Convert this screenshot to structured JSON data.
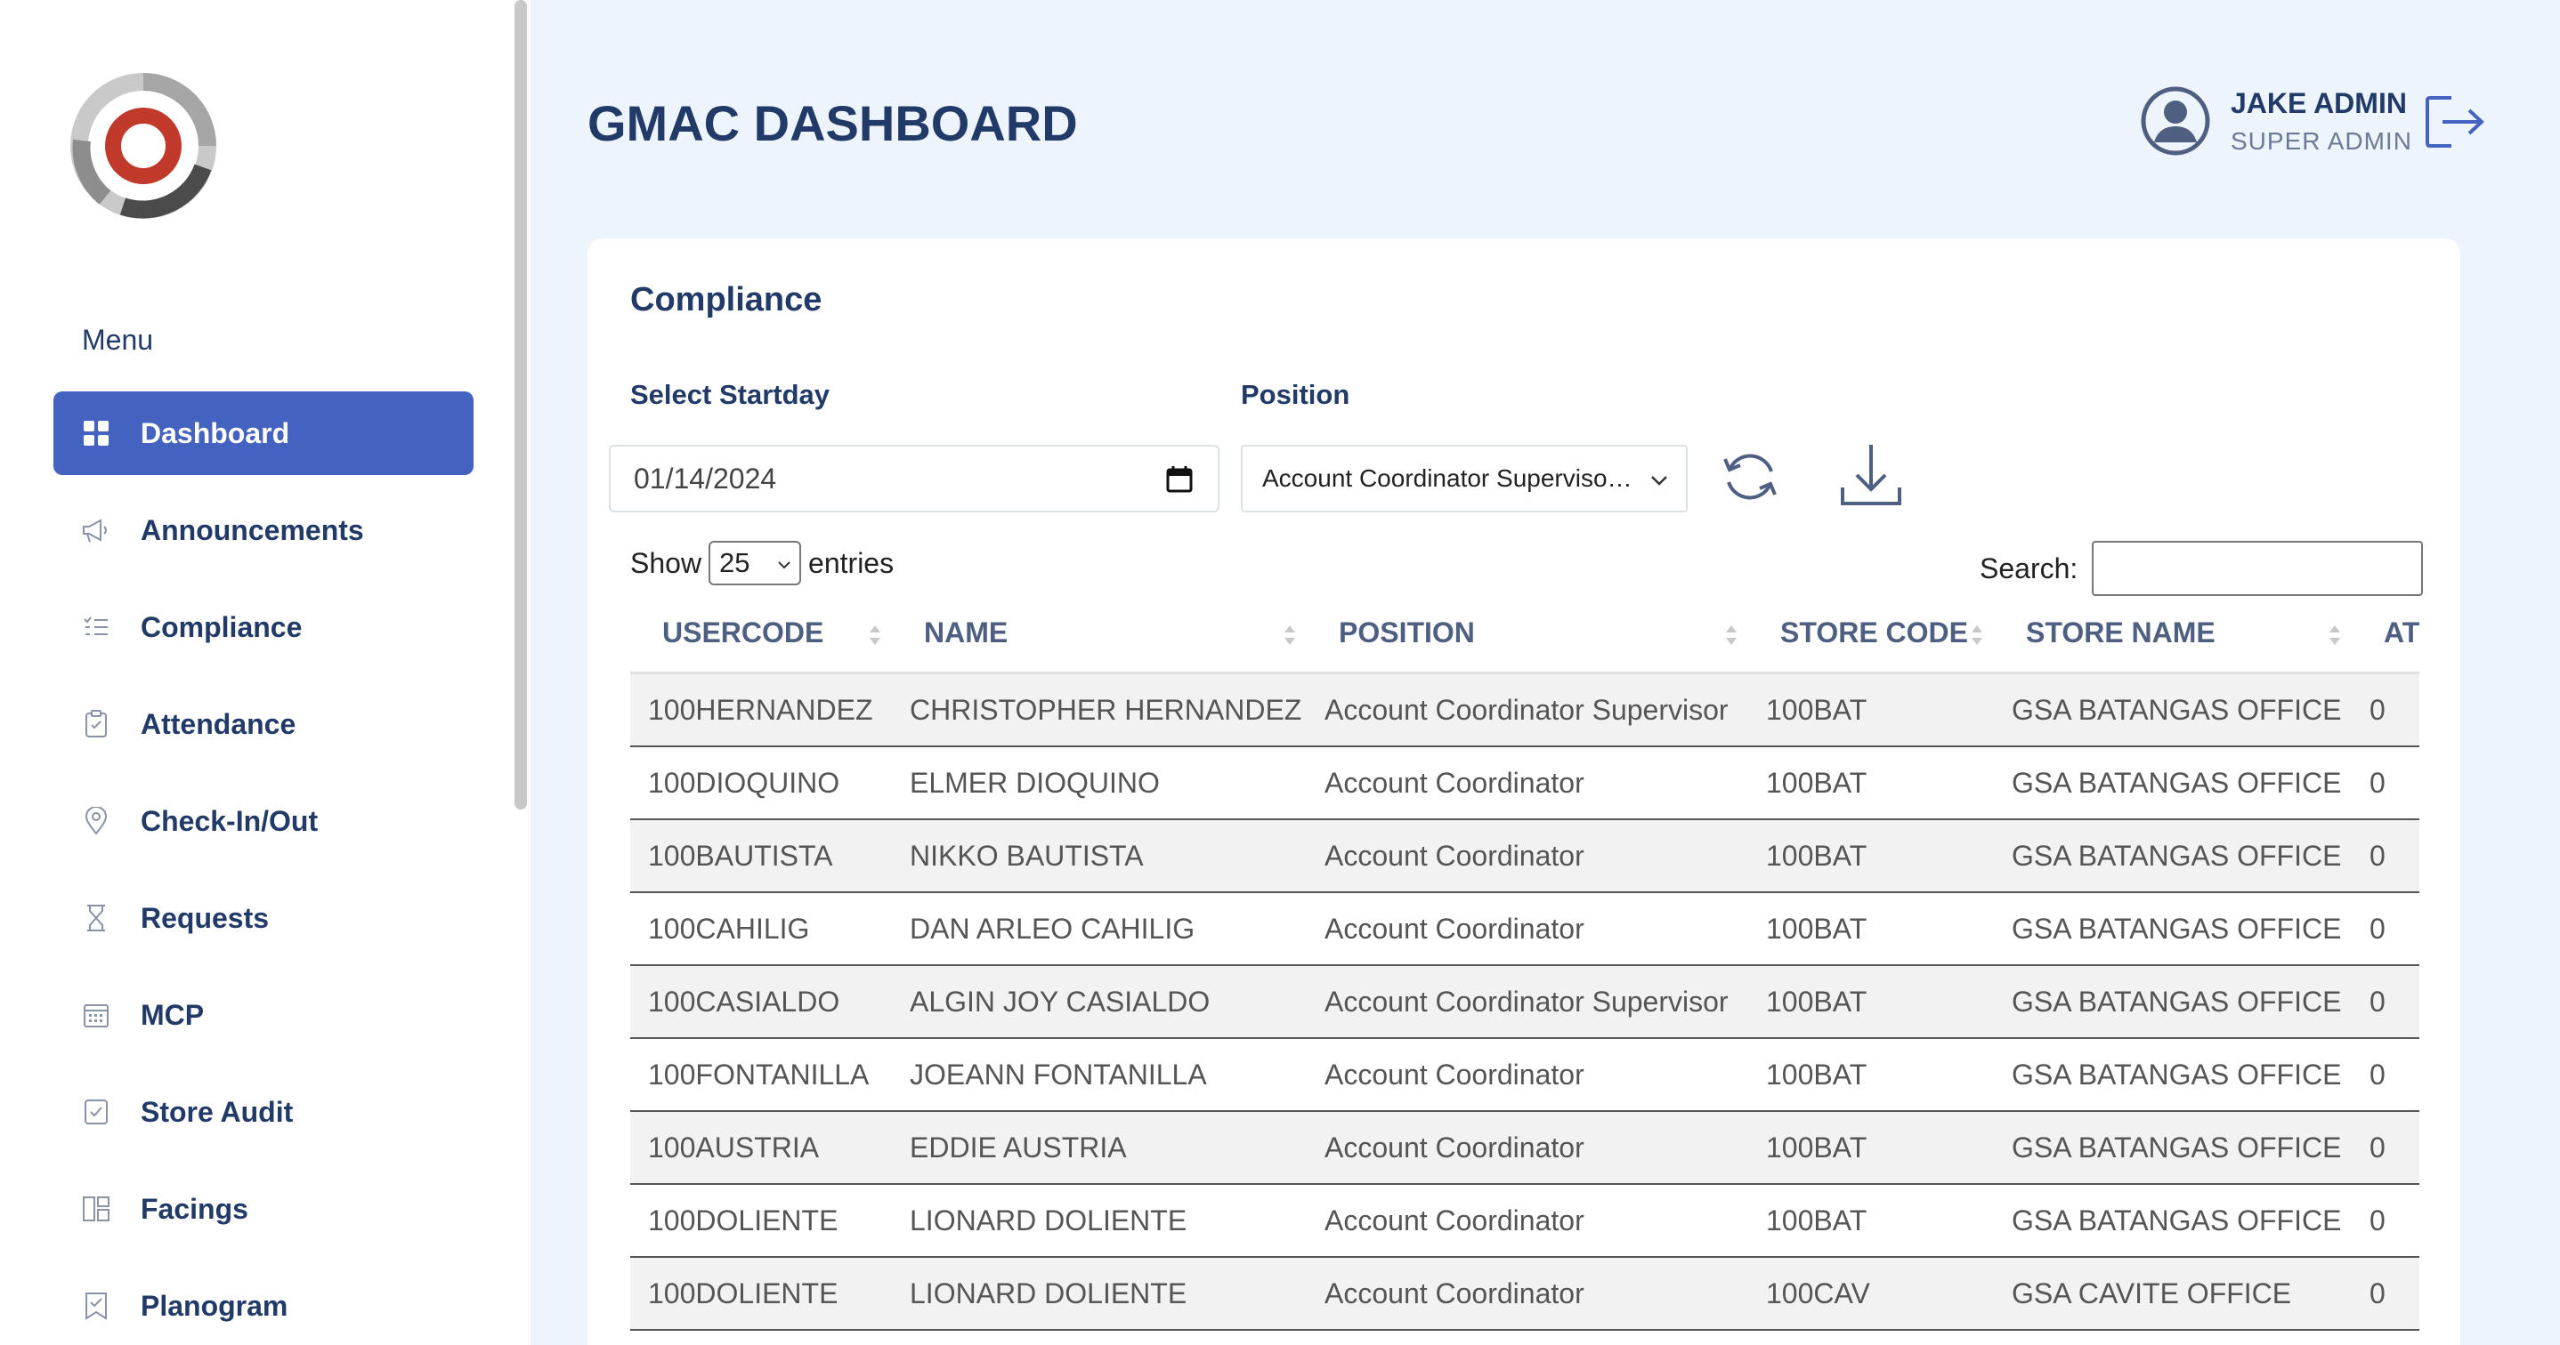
{
  "sidebar": {
    "menu_title": "Menu",
    "items": [
      {
        "label": "Dashboard",
        "icon": "grid-icon",
        "active": true
      },
      {
        "label": "Announcements",
        "icon": "megaphone-icon"
      },
      {
        "label": "Compliance",
        "icon": "checklist-icon"
      },
      {
        "label": "Attendance",
        "icon": "clipboard-icon"
      },
      {
        "label": "Check-In/Out",
        "icon": "location-pin-icon"
      },
      {
        "label": "Requests",
        "icon": "hourglass-icon"
      },
      {
        "label": "MCP",
        "icon": "calendar-icon"
      },
      {
        "label": "Store Audit",
        "icon": "check-square-icon"
      },
      {
        "label": "Facings",
        "icon": "layout-icon"
      },
      {
        "label": "Planogram",
        "icon": "bookmark-check-icon"
      }
    ]
  },
  "header": {
    "title": "GMAC DASHBOARD",
    "user_name": "JAKE ADMIN",
    "user_role": "SUPER ADMIN"
  },
  "card": {
    "title": "Compliance",
    "start_label": "Select Startday",
    "position_label": "Position",
    "start_value": "01/14/2024",
    "position_value": "Account Coordinator Superviso…",
    "show_label": "Show",
    "entries_value": "25",
    "entries_label": "entries",
    "search_label": "Search:"
  },
  "table": {
    "columns": [
      "USERCODE",
      "NAME",
      "POSITION",
      "STORE CODE",
      "STORE NAME",
      "AT"
    ],
    "rows": [
      [
        "100HERNANDEZ",
        "CHRISTOPHER HERNANDEZ",
        "Account Coordinator Supervisor",
        "100BAT",
        "GSA BATANGAS OFFICE",
        "0"
      ],
      [
        "100DIOQUINO",
        "ELMER DIOQUINO",
        "Account Coordinator",
        "100BAT",
        "GSA BATANGAS OFFICE",
        "0"
      ],
      [
        "100BAUTISTA",
        "NIKKO BAUTISTA",
        "Account Coordinator",
        "100BAT",
        "GSA BATANGAS OFFICE",
        "0"
      ],
      [
        "100CAHILIG",
        "DAN ARLEO CAHILIG",
        "Account Coordinator",
        "100BAT",
        "GSA BATANGAS OFFICE",
        "0"
      ],
      [
        "100CASIALDO",
        "ALGIN JOY CASIALDO",
        "Account Coordinator Supervisor",
        "100BAT",
        "GSA BATANGAS OFFICE",
        "0"
      ],
      [
        "100FONTANILLA",
        "JOEANN FONTANILLA",
        "Account Coordinator",
        "100BAT",
        "GSA BATANGAS OFFICE",
        "0"
      ],
      [
        "100AUSTRIA",
        "EDDIE AUSTRIA",
        "Account Coordinator",
        "100BAT",
        "GSA BATANGAS OFFICE",
        "0"
      ],
      [
        "100DOLIENTE",
        "LIONARD DOLIENTE",
        "Account Coordinator",
        "100BAT",
        "GSA BATANGAS OFFICE",
        "0"
      ],
      [
        "100DOLIENTE",
        "LIONARD DOLIENTE",
        "Account Coordinator",
        "100CAV",
        "GSA CAVITE OFFICE",
        "0"
      ]
    ]
  },
  "colors": {
    "accent": "#4462bf",
    "text_dark": "#213a68",
    "background": "#eef4fc"
  }
}
